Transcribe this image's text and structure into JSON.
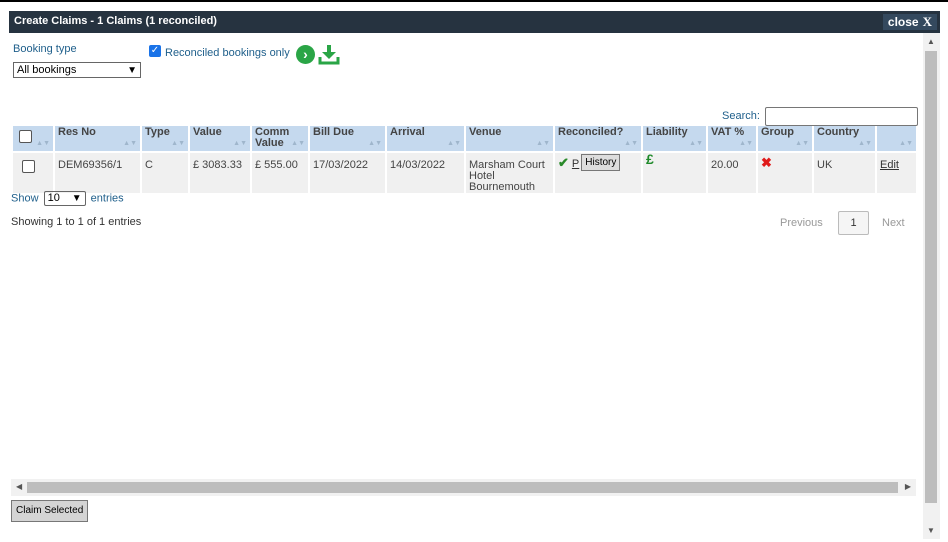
{
  "dialog": {
    "title": "Create Claims - 1 Claims (1 reconciled)",
    "close_label": "close",
    "close_icon": "X"
  },
  "filters": {
    "booking_type_label": "Booking type",
    "booking_type_value": "All bookings",
    "reconciled_only_label": "Reconciled bookings only",
    "reconciled_only_checked": true
  },
  "search": {
    "label": "Search:",
    "value": ""
  },
  "table": {
    "columns": [
      "Res No",
      "Type",
      "Value",
      "Comm Value",
      "Bill Due",
      "Arrival",
      "Venue",
      "Reconciled?",
      "Liability",
      "VAT %",
      "Group",
      "Country",
      ""
    ],
    "rows": [
      {
        "res_no": "DEM69356/1",
        "type": "C",
        "value": "£ 3083.33",
        "comm_value": "£ 555.00",
        "bill_due": "17/03/2022",
        "arrival": "14/03/2022",
        "venue": "Marsham Court Hotel Bournemouth",
        "reconciled_link": "P",
        "history_label": "History",
        "liability_icon": "£",
        "vat": "20.00",
        "country": "UK",
        "edit_label": "Edit"
      }
    ]
  },
  "length": {
    "show_label": "Show",
    "value": "10",
    "entries_label": "entries"
  },
  "info_text": "Showing 1 to 1 of 1 entries",
  "pager": {
    "previous": "Previous",
    "current": "1",
    "next": "Next"
  },
  "footer": {
    "claim_selected_label": "Claim Selected"
  },
  "colors": {
    "title_bar": "#263340",
    "header_bg": "#c5d9ee",
    "row_bg": "#f0f0f0",
    "go_green": "#2aa546",
    "error_red": "#e01b1b"
  }
}
